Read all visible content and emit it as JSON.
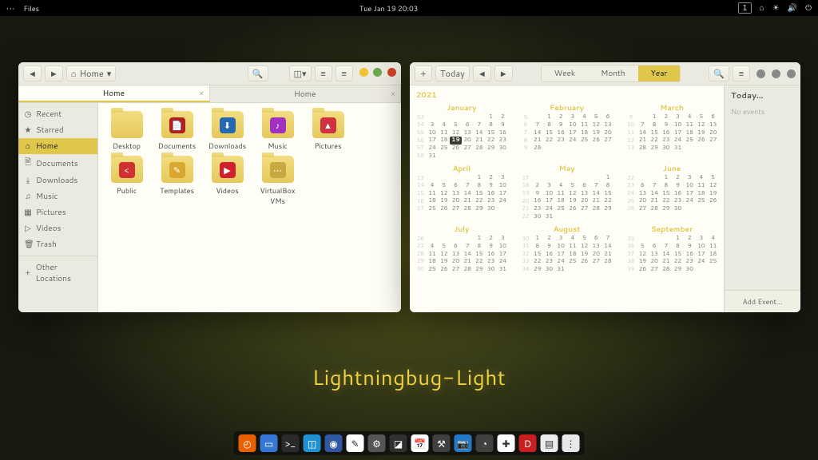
{
  "topbar": {
    "app_label": "Files",
    "clock": "Tue Jan 19  20:03",
    "workspace": "1"
  },
  "files": {
    "path_label": "Home",
    "tabs": [
      {
        "label": "Home",
        "active": true
      },
      {
        "label": "Home",
        "active": false
      }
    ],
    "sidebar": [
      {
        "label": "Recent",
        "icon": "◷"
      },
      {
        "label": "Starred",
        "icon": "★"
      },
      {
        "label": "Home",
        "icon": "⌂",
        "active": true
      },
      {
        "label": "Documents",
        "icon": "🖹"
      },
      {
        "label": "Downloads",
        "icon": "⤓"
      },
      {
        "label": "Music",
        "icon": "♫"
      },
      {
        "label": "Pictures",
        "icon": "▦"
      },
      {
        "label": "Videos",
        "icon": "▷"
      },
      {
        "label": "Trash",
        "icon": "🗑"
      }
    ],
    "other_locations": "Other Locations",
    "folders": [
      {
        "name": "Desktop",
        "emblem": "",
        "emb_bg": ""
      },
      {
        "name": "Documents",
        "emblem": "📄",
        "emb_bg": "#b02020"
      },
      {
        "name": "Downloads",
        "emblem": "⬇",
        "emb_bg": "#2468b0"
      },
      {
        "name": "Music",
        "emblem": "♪",
        "emb_bg": "#a030c0"
      },
      {
        "name": "Pictures",
        "emblem": "▲",
        "emb_bg": "#d03040"
      },
      {
        "name": "Public",
        "emblem": "<",
        "emb_bg": "#d03030"
      },
      {
        "name": "Templates",
        "emblem": "✎",
        "emb_bg": "#d8a830"
      },
      {
        "name": "Videos",
        "emblem": "▶",
        "emb_bg": "#d02030"
      },
      {
        "name": "VirtualBox VMs",
        "emblem": "⋯",
        "emb_bg": "#c8a840"
      }
    ]
  },
  "cal": {
    "today_btn": "Today",
    "views": {
      "week": "Week",
      "month": "Month",
      "year": "Year"
    },
    "active_view": "year",
    "year_label": "2021",
    "right_head": "Today…",
    "no_events": "No events",
    "add_event": "Add Event…",
    "months": [
      "January",
      "February",
      "March",
      "April",
      "May",
      "June",
      "July",
      "August",
      "September"
    ],
    "month_starts": [
      5,
      1,
      1,
      4,
      6,
      2,
      4,
      0,
      3
    ],
    "month_lengths": [
      31,
      28,
      31,
      30,
      31,
      30,
      31,
      31,
      30
    ],
    "week_start_iso": [
      53,
      5,
      9,
      13,
      17,
      22,
      26,
      30,
      35
    ],
    "today": {
      "month_index": 0,
      "day": 19
    }
  },
  "theme_name": "Lightningbug-Light",
  "dock": [
    {
      "bg": "#e86000",
      "glyph": "◴"
    },
    {
      "bg": "#3478d4",
      "glyph": "▭"
    },
    {
      "bg": "#2a2a2a",
      "glyph": ">_"
    },
    {
      "bg": "#2090d0",
      "glyph": "◫"
    },
    {
      "bg": "#3058a0",
      "glyph": "◉"
    },
    {
      "bg": "#ffffff",
      "glyph": "✎"
    },
    {
      "bg": "#555555",
      "glyph": "⚙"
    },
    {
      "bg": "#303030",
      "glyph": "◪"
    },
    {
      "bg": "#ffffff",
      "glyph": "📅"
    },
    {
      "bg": "#404040",
      "glyph": "⚒"
    },
    {
      "bg": "#2478c8",
      "glyph": "📷"
    },
    {
      "bg": "#404040",
      "glyph": "◔"
    },
    {
      "bg": "#ffffff",
      "glyph": "✚"
    },
    {
      "bg": "#c82020",
      "glyph": "D"
    },
    {
      "bg": "#ececec",
      "glyph": "▤"
    },
    {
      "bg": "#e8e8e8",
      "glyph": "⋮⋮⋮"
    }
  ]
}
